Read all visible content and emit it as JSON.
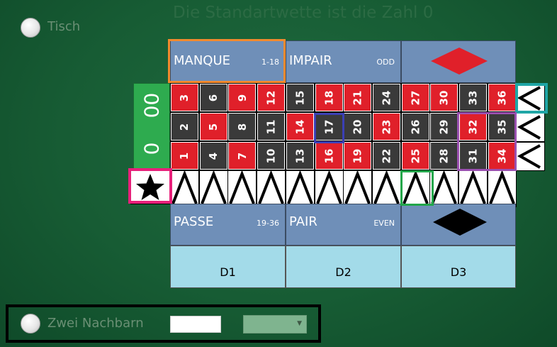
{
  "title": "Die Standartwette ist die Zahl 0",
  "tisch_label": "Tisch",
  "zwei_nachbarn_label": "Zwei Nachbarn",
  "outside_top": {
    "manque": "MANQUE",
    "manque_range": "1-18",
    "impair": "IMPAIR",
    "impair_en": "ODD"
  },
  "outside_bottom": {
    "passe": "PASSE",
    "passe_range": "19-36",
    "pair": "PAIR",
    "pair_en": "EVEN"
  },
  "zeros": [
    "00",
    "0"
  ],
  "rows": [
    [
      {
        "n": "3",
        "c": "red"
      },
      {
        "n": "6",
        "c": "black"
      },
      {
        "n": "9",
        "c": "red"
      },
      {
        "n": "12",
        "c": "red"
      },
      {
        "n": "15",
        "c": "black"
      },
      {
        "n": "18",
        "c": "red"
      },
      {
        "n": "21",
        "c": "red"
      },
      {
        "n": "24",
        "c": "black"
      },
      {
        "n": "27",
        "c": "red"
      },
      {
        "n": "30",
        "c": "red"
      },
      {
        "n": "33",
        "c": "black"
      },
      {
        "n": "36",
        "c": "red"
      }
    ],
    [
      {
        "n": "2",
        "c": "black"
      },
      {
        "n": "5",
        "c": "red"
      },
      {
        "n": "8",
        "c": "black"
      },
      {
        "n": "11",
        "c": "black"
      },
      {
        "n": "14",
        "c": "red"
      },
      {
        "n": "17",
        "c": "black"
      },
      {
        "n": "20",
        "c": "black"
      },
      {
        "n": "23",
        "c": "red"
      },
      {
        "n": "26",
        "c": "black"
      },
      {
        "n": "29",
        "c": "black"
      },
      {
        "n": "32",
        "c": "red"
      },
      {
        "n": "35",
        "c": "black"
      }
    ],
    [
      {
        "n": "1",
        "c": "red"
      },
      {
        "n": "4",
        "c": "black"
      },
      {
        "n": "7",
        "c": "red"
      },
      {
        "n": "10",
        "c": "black"
      },
      {
        "n": "13",
        "c": "black"
      },
      {
        "n": "16",
        "c": "red"
      },
      {
        "n": "19",
        "c": "red"
      },
      {
        "n": "22",
        "c": "black"
      },
      {
        "n": "25",
        "c": "red"
      },
      {
        "n": "28",
        "c": "black"
      },
      {
        "n": "31",
        "c": "black"
      },
      {
        "n": "34",
        "c": "red"
      }
    ]
  ],
  "dozens": [
    "D1",
    "D2",
    "D3"
  ],
  "colors": {
    "red": "#e0202a",
    "black": "#3a3a3a",
    "green": "#2eab4f",
    "outside_blue": "#6f8fb8",
    "dozen_blue": "#a3dbe9",
    "highlight_orange": "#f28a2e",
    "highlight_teal": "#1fa6a6",
    "highlight_blue": "#3b3fb5",
    "highlight_purple": "#9a4fb0",
    "highlight_green": "#22a64a",
    "highlight_pink": "#e8207a"
  },
  "icons": {
    "red_diamond": "diamond-red",
    "black_diamond": "diamond-black",
    "star": "star",
    "chevron_left": "chevron-left",
    "chevron_up": "chevron-up",
    "dropdown_arrow": "caret-down"
  }
}
